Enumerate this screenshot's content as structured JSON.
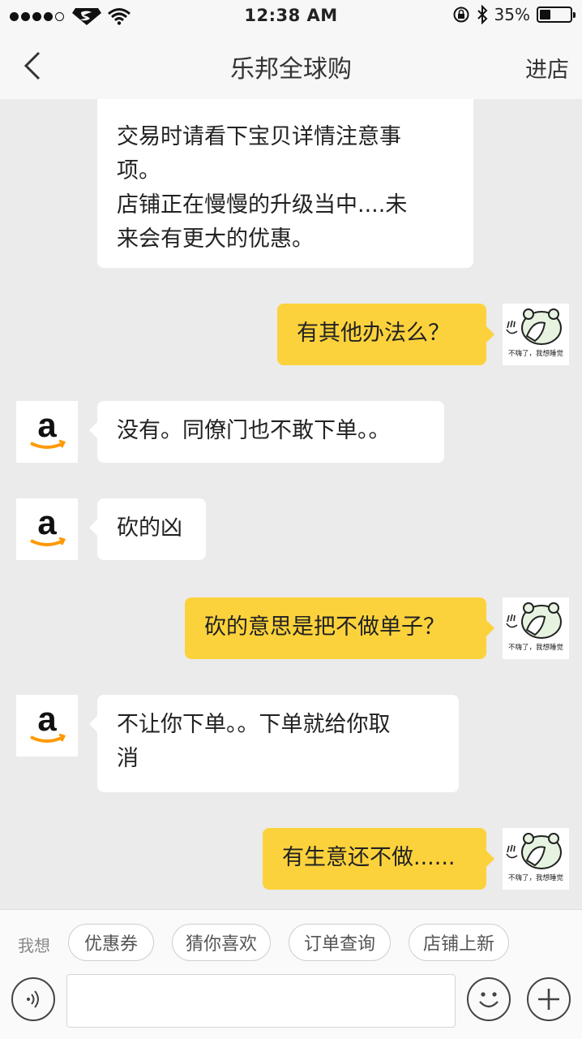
{
  "status_bar": {
    "time": "12:38 AM",
    "battery_percent": "35%",
    "battery_level": 0.35,
    "signal_bars_filled": 4,
    "icons": [
      "signal-dots-icon",
      "carrier-logo-icon",
      "wifi-icon",
      "rotation-lock-icon",
      "bluetooth-icon",
      "battery-icon"
    ]
  },
  "nav": {
    "title": "乐邦全球购",
    "action": "进店",
    "back_icon": "chevron-left-icon"
  },
  "messages": [
    {
      "side": "in",
      "lines": [
        "交易时请看下宝贝详情注意事",
        "项。",
        "店铺正在慢慢的升级当中....未",
        "来会有更大的优惠。"
      ]
    },
    {
      "side": "out",
      "text": "有其他办法么？"
    },
    {
      "side": "in",
      "text": "没有。同僚门也不敢下单。。"
    },
    {
      "side": "in",
      "text": "砍的凶"
    },
    {
      "side": "out",
      "text": "砍的意思是把不做单子？"
    },
    {
      "side": "in",
      "lines": [
        "不让你下单。。下单就给你取",
        "消"
      ]
    },
    {
      "side": "out",
      "text": "有生意还不做......"
    }
  ],
  "avatars": {
    "shop": {
      "letter": "a",
      "icon": "amazon-logo-icon",
      "brand_color": "#ff9900"
    },
    "user": {
      "caption": "不嗨了，我想睡觉",
      "icon": "bear-covering-face-sticker"
    }
  },
  "quick_replies": {
    "label": "我想",
    "chips": [
      "优惠券",
      "猜你喜欢",
      "订单查询",
      "店铺上新"
    ]
  },
  "input_bar": {
    "value": "",
    "icons": [
      "voice-icon",
      "emoji-icon",
      "plus-icon"
    ]
  },
  "colors": {
    "outgoing_bubble": "#fcd23c",
    "incoming_bubble": "#ffffff",
    "background": "#ebebeb"
  }
}
